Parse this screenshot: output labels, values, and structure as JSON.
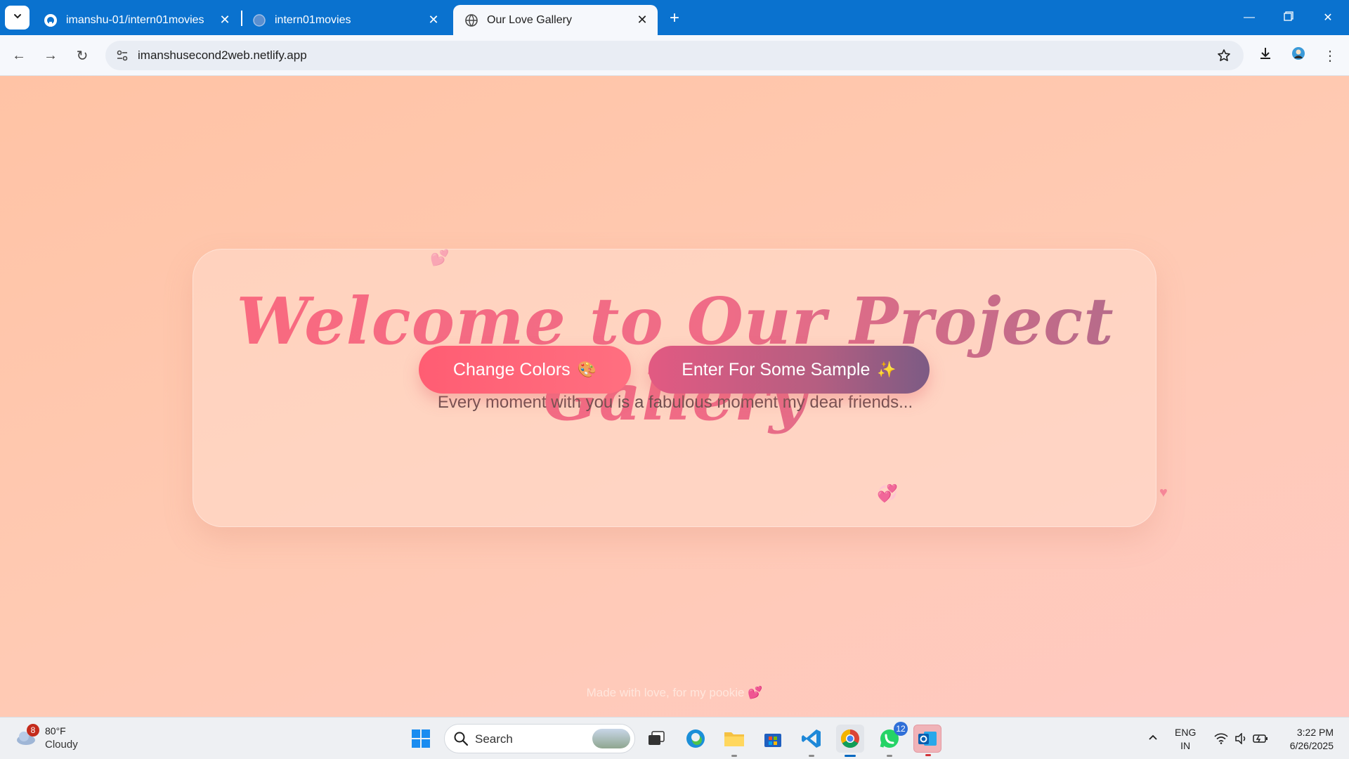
{
  "browser": {
    "tabs": [
      {
        "title": "imanshu-01/intern01movies",
        "icon": "github-icon",
        "active": false
      },
      {
        "title": "intern01movies",
        "icon": "globe-icon",
        "active": false
      },
      {
        "title": "Our Love Gallery",
        "icon": "globe-icon",
        "active": true
      }
    ],
    "url": "imanshusecond2web.netlify.app"
  },
  "page": {
    "title": "Welcome to Our Project Gallery",
    "subtitle": "Every moment with you is a fabulous moment my dear friends...",
    "buttons": {
      "change_colors": "Change Colors",
      "change_colors_emoji": "🎨",
      "enter_sample": "Enter For Some Sample",
      "enter_sample_emoji": "✨"
    },
    "footer": "Made with love, for my pookie 💕"
  },
  "taskbar": {
    "weather": {
      "temp": "80°F",
      "condition": "Cloudy",
      "badge": "8"
    },
    "search_label": "Search",
    "apps": [
      {
        "name": "windows-start-icon"
      },
      {
        "name": "task-view-icon"
      },
      {
        "name": "edge-icon"
      },
      {
        "name": "file-explorer-icon"
      },
      {
        "name": "microsoft-store-icon"
      },
      {
        "name": "vscode-icon"
      },
      {
        "name": "chrome-icon"
      },
      {
        "name": "whatsapp-icon",
        "badge": "12"
      },
      {
        "name": "outlook-icon"
      }
    ],
    "language": {
      "line1": "ENG",
      "line2": "IN"
    },
    "time": "3:22 PM",
    "date": "6/26/2025"
  },
  "colors": {
    "titlebar": "#0a72cf",
    "page_bg": "#ffc9ae",
    "accent_pink": "#ff5d73",
    "accent_purple": "#7c5b84"
  }
}
